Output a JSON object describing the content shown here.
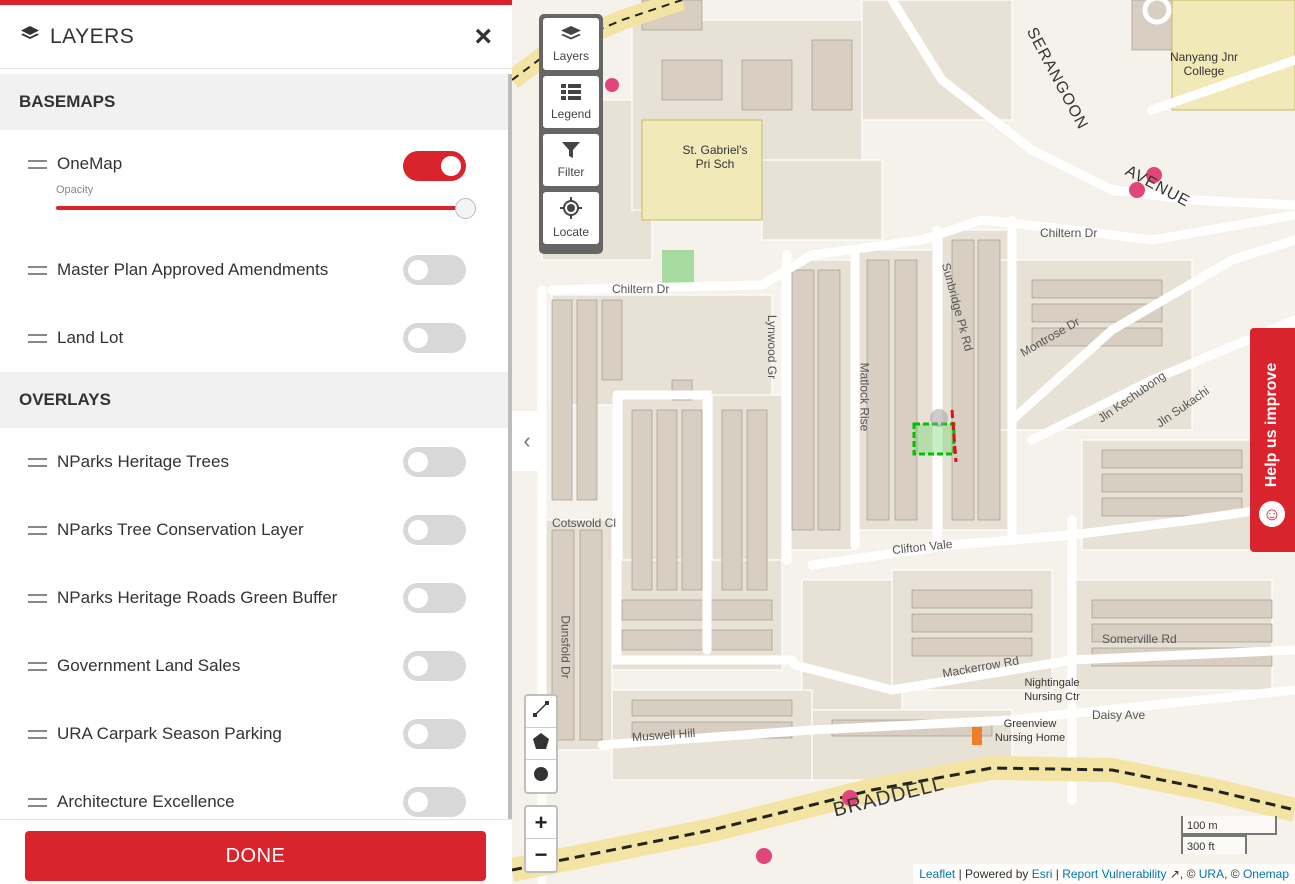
{
  "panel": {
    "title": "LAYERS",
    "close_symbol": "×",
    "basemaps": {
      "heading": "BASEMAPS",
      "items": [
        {
          "label": "OneMap",
          "enabled": true,
          "opacity_label": "Opacity",
          "opacity": 1.0
        },
        {
          "label": "Master Plan Approved Amendments",
          "enabled": false
        },
        {
          "label": "Land Lot",
          "enabled": false
        }
      ]
    },
    "overlays": {
      "heading": "OVERLAYS",
      "items": [
        {
          "label": "NParks Heritage Trees",
          "enabled": false
        },
        {
          "label": "NParks Tree Conservation Layer",
          "enabled": false
        },
        {
          "label": "NParks Heritage Roads Green Buffer",
          "enabled": false
        },
        {
          "label": "Government Land Sales",
          "enabled": false
        },
        {
          "label": "URA Carpark Season Parking",
          "enabled": false
        },
        {
          "label": "Architecture Excellence",
          "enabled": false
        }
      ]
    },
    "done_label": "DONE"
  },
  "map": {
    "tools": [
      {
        "label": "Layers",
        "icon": "layers-icon"
      },
      {
        "label": "Legend",
        "icon": "legend-icon"
      },
      {
        "label": "Filter",
        "icon": "filter-icon"
      },
      {
        "label": "Locate",
        "icon": "locate-icon"
      }
    ],
    "draw_tools": [
      "line-icon",
      "polygon-icon",
      "circle-icon"
    ],
    "zoom_in": "+",
    "zoom_out": "−",
    "collapse_symbol": "‹",
    "scale": {
      "metric": "100 m",
      "imperial": "300 ft"
    },
    "help_label": "Help us improve",
    "attribution": {
      "leaflet": "Leaflet",
      "powered_by": "| Powered by",
      "esri": "Esri",
      "sep1": "|",
      "report": "Report Vulnerability",
      "ura_prefix": ", ©",
      "ura": "URA",
      "onemap_prefix": ", ©",
      "onemap": "Onemap"
    },
    "labels": {
      "school_st_gabriels": "St. Gabriel's Pri Sch",
      "nanyang": "Nanyang Jnr College",
      "serangoon": "SERANGOON",
      "avenue": "AVENUE",
      "braddell": "BRADDELL",
      "chiltern_dr": "Chiltern Dr",
      "chiltern_dr_2": "Chiltern Dr",
      "cotswold_cl": "Cotswold Cl",
      "clifton_vale": "Clifton Vale",
      "matlock_rise": "Matlock Rise",
      "mackerrow_rd": "Mackerrow Rd",
      "muswell_hill": "Muswell Hill",
      "dunsfold_dr": "Dunsfold Dr",
      "lynwood_gr": "Lynwood Gr",
      "sunbridge": "Sunbridge Pk Rd",
      "nightingale": "Nightingale Nursing Ctr",
      "greenview": "Greenview Nursing Home",
      "jln_sukachi": "Jln Sukachi",
      "somerville": "Somerville Rd",
      "daisy_ave": "Daisy Ave",
      "jln_kechubong": "Jln Kechubong",
      "montrose": "Montrose Dr"
    }
  }
}
